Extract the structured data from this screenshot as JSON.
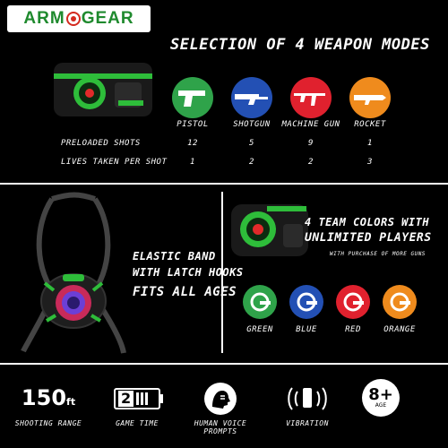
{
  "brand": {
    "name_left": "ARM",
    "name_right": "GEAR"
  },
  "headline": "SELECTION OF 4 WEAPON MODES",
  "weapons": [
    {
      "name": "PISTOL",
      "color": "#2fa34a",
      "icon": "pistol-icon"
    },
    {
      "name": "SHOTGUN",
      "color": "#2350b4",
      "icon": "shotgun-icon"
    },
    {
      "name": "MACHINE GUN",
      "color": "#e0212e",
      "icon": "machine-gun-icon"
    },
    {
      "name": "ROCKET",
      "color": "#ef8b1d",
      "icon": "rocket-icon"
    }
  ],
  "stats": {
    "preloaded_label": "PRELOADED SHOTS",
    "preloaded": [
      "12",
      "5",
      "9",
      "1"
    ],
    "lives_label": "LIVES TAKEN PER SHOT",
    "lives": [
      "1",
      "2",
      "2",
      "3"
    ]
  },
  "vest": {
    "line1": "ELASTIC BAND",
    "line2": "WITH LATCH HOOKS",
    "line3": "FITS ALL AGES"
  },
  "team": {
    "line1": "4 TEAM COLORS WITH",
    "line2": "UNLIMITED PLAYERS",
    "note": "WITH PURCHASE OF MORE GUNS",
    "colors": [
      {
        "name": "GREEN",
        "color": "#2fa34a"
      },
      {
        "name": "BLUE",
        "color": "#2350b4"
      },
      {
        "name": "RED",
        "color": "#e0212e"
      },
      {
        "name": "ORANGE",
        "color": "#ef8b1d"
      }
    ]
  },
  "features": {
    "range_value": "150",
    "range_unit": "ft",
    "range_label": "SHOOTING RANGE",
    "game_time_value": "2",
    "game_time_label": "GAME TIME",
    "voice_label": "HUMAN VOICE PROMPTS",
    "vibration_label": "VIBRATION",
    "age_value": "8+",
    "age_unit": "AGE"
  }
}
